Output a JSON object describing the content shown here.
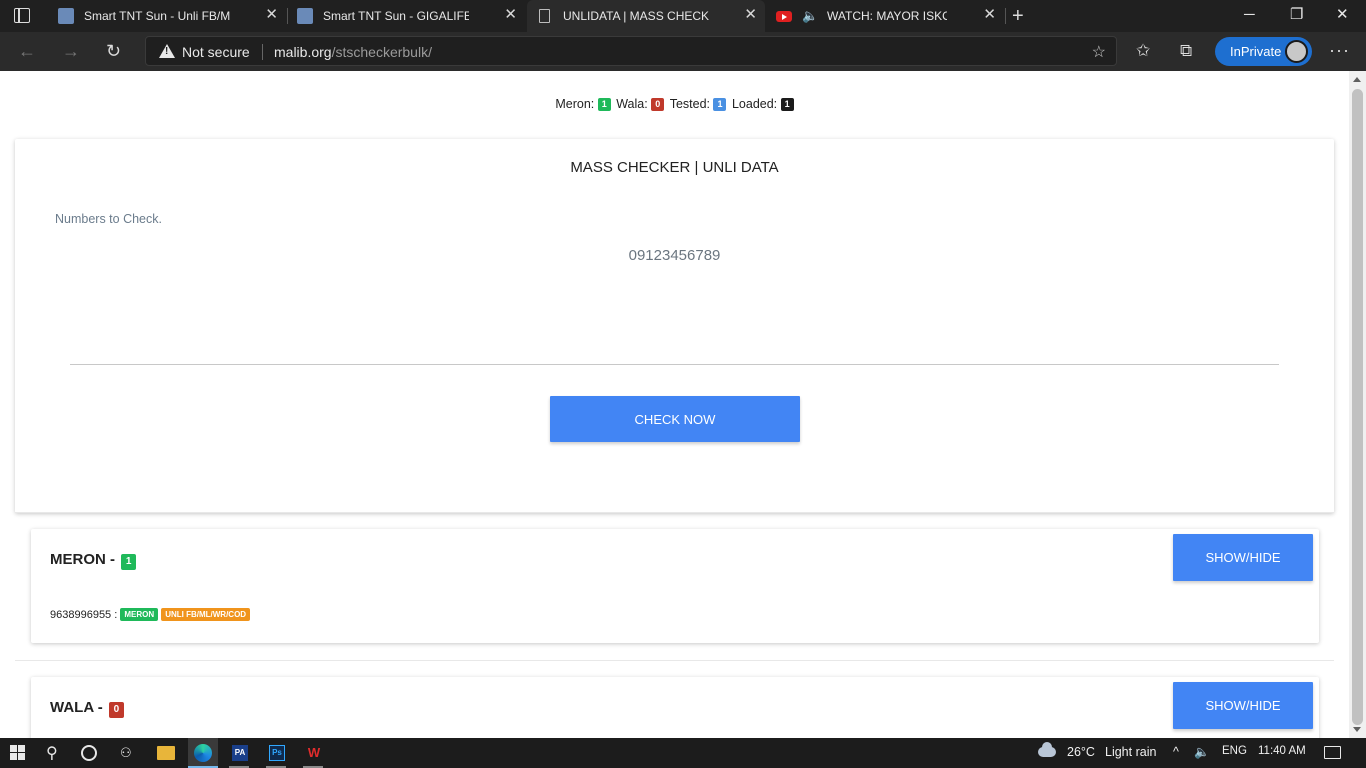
{
  "browser": {
    "tabs": [
      {
        "title": "Smart TNT Sun - Unli FB/ML/COD"
      },
      {
        "title": "Smart TNT Sun - GIGALIFE UNLI"
      },
      {
        "title": "UNLIDATA | MASS CHECKER"
      },
      {
        "title": "WATCH: MAYOR ISKO MORENO"
      }
    ],
    "security_label": "Not secure",
    "url_host": "malib.org",
    "url_path": "/stscheckerbulk/",
    "inprivate_label": "InPrivate"
  },
  "stats": {
    "meron_label": "Meron:",
    "meron_count": "1",
    "wala_label": "Wala:",
    "wala_count": "0",
    "tested_label": "Tested:",
    "tested_count": "1",
    "loaded_label": "Loaded:",
    "loaded_count": "1"
  },
  "checker": {
    "title": "MASS CHECKER | UNLI DATA",
    "field_label": "Numbers to Check.",
    "numbers_value": "09123456789",
    "check_button": "CHECK NOW"
  },
  "results": {
    "meron": {
      "title": "MERON -",
      "count": "1",
      "toggle_label": "SHOW/HIDE",
      "entries": [
        {
          "number": "9638996955 :",
          "status": "MERON",
          "promo": "UNLI FB/ML/WR/COD"
        }
      ]
    },
    "wala": {
      "title": "WALA -",
      "count": "0",
      "toggle_label": "SHOW/HIDE"
    }
  },
  "taskbar": {
    "temperature": "26°C",
    "weather": "Light rain",
    "language": "ENG",
    "time": "11:40 AM"
  },
  "colors": {
    "primary_button": "#4285f4",
    "badge_green": "#1fb95a",
    "badge_red": "#c0392b",
    "badge_blue": "#4a90e2",
    "badge_dark": "#1b1b1b",
    "tag_orange": "#f0941c",
    "inprivate": "#1e6fd0"
  }
}
